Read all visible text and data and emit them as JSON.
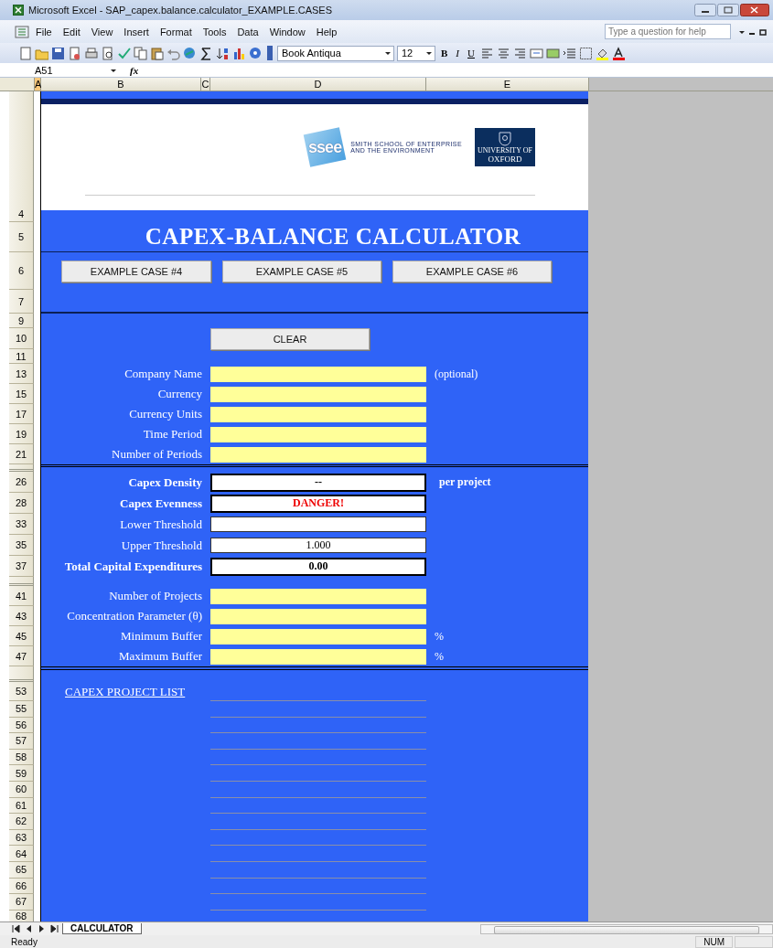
{
  "window": {
    "title": "Microsoft Excel - SAP_capex.balance.calculator_EXAMPLE.CASES"
  },
  "menu_bar": {
    "items": [
      "File",
      "Edit",
      "View",
      "Insert",
      "Format",
      "Tools",
      "Data",
      "Window",
      "Help"
    ],
    "help_search": {
      "placeholder": "Type a question for help"
    }
  },
  "toolbar": {
    "font": "Book Antiqua",
    "font_size": "12",
    "format_buttons": [
      "B",
      "I",
      "U"
    ]
  },
  "formula_bar": {
    "name_box": "A51",
    "function_label": "fx"
  },
  "column_headers": [
    {
      "label": "A",
      "selected": true
    },
    {
      "label": "B",
      "selected": false
    },
    {
      "label": "C",
      "selected": false
    },
    {
      "label": "D",
      "selected": false
    },
    {
      "label": "E",
      "selected": false
    }
  ],
  "banner": {
    "logo_mark": "ssee",
    "school_line_1": "SMITH SCHOOL OF ENTERPRISE",
    "school_line_2": "AND THE ENVIRONMENT",
    "university_small": "UNIVERSITY OF",
    "university": "OXFORD"
  },
  "rows": [
    {
      "kind": "banner",
      "number": "4"
    },
    {
      "kind": "title",
      "number": "5",
      "text": "CAPEX-BALANCE CALCULATOR"
    },
    {
      "kind": "buttons",
      "number": "6",
      "buttons": [
        "EXAMPLE CASE #4",
        "EXAMPLE CASE #5",
        "EXAMPLE CASE #6"
      ]
    },
    {
      "kind": "blank",
      "number": "7"
    },
    {
      "kind": "blank",
      "number": "9"
    },
    {
      "kind": "button",
      "number": "10",
      "label": "CLEAR"
    },
    {
      "kind": "blank",
      "number": "11"
    },
    {
      "kind": "input",
      "number": "13",
      "label": "Company Name",
      "note": "(optional)"
    },
    {
      "kind": "input",
      "number": "15",
      "label": "Currency"
    },
    {
      "kind": "input",
      "number": "17",
      "label": "Currency Units"
    },
    {
      "kind": "input",
      "number": "19",
      "label": "Time Period"
    },
    {
      "kind": "input",
      "number": "21",
      "label": "Number of Periods"
    },
    {
      "kind": "break"
    },
    {
      "kind": "output",
      "number": "26",
      "label": "Capex Density",
      "value": "--",
      "note": "per project",
      "emphasis": true,
      "alert": false
    },
    {
      "kind": "output",
      "number": "28",
      "label": "Capex Evenness",
      "value": "DANGER!",
      "emphasis": true,
      "alert": true
    },
    {
      "kind": "output",
      "number": "33",
      "label": "Lower Threshold",
      "emphasis": false
    },
    {
      "kind": "output",
      "number": "35",
      "label": "Upper Threshold",
      "value": "1.000",
      "emphasis": false,
      "alert": false
    },
    {
      "kind": "output",
      "number": "37",
      "label": "Total Capital Expenditures",
      "value": "0.00",
      "emphasis": true,
      "alert": false
    },
    {
      "kind": "gap"
    },
    {
      "kind": "input",
      "number": "41",
      "label": "Number of Projects"
    },
    {
      "kind": "input",
      "number": "43",
      "label": "Concentration Parameter (θ)"
    },
    {
      "kind": "input",
      "number": "45",
      "label": "Minimum Buffer",
      "note": "%"
    },
    {
      "kind": "input",
      "number": "47",
      "label": "Maximum Buffer",
      "note": "%"
    },
    {
      "kind": "break2"
    },
    {
      "kind": "list_title",
      "number": "53",
      "text": "CAPEX PROJECT LIST"
    },
    {
      "kind": "list_line",
      "number": "55"
    },
    {
      "kind": "list_line",
      "number": "56"
    },
    {
      "kind": "list_line",
      "number": "57"
    },
    {
      "kind": "list_line",
      "number": "58"
    },
    {
      "kind": "list_line",
      "number": "59"
    },
    {
      "kind": "list_line",
      "number": "60"
    },
    {
      "kind": "list_line",
      "number": "61"
    },
    {
      "kind": "list_line",
      "number": "62"
    },
    {
      "kind": "list_line",
      "number": "63"
    },
    {
      "kind": "list_line",
      "number": "64"
    },
    {
      "kind": "list_line",
      "number": "65"
    },
    {
      "kind": "list_line",
      "number": "66"
    },
    {
      "kind": "list_line",
      "number": "67"
    },
    {
      "kind": "tail",
      "number": "68"
    }
  ],
  "sheet_tabs": [
    {
      "label": "CALCULATOR",
      "selected": true
    }
  ],
  "status_bar": {
    "text": "Ready",
    "indicators": [
      "NUM"
    ]
  }
}
